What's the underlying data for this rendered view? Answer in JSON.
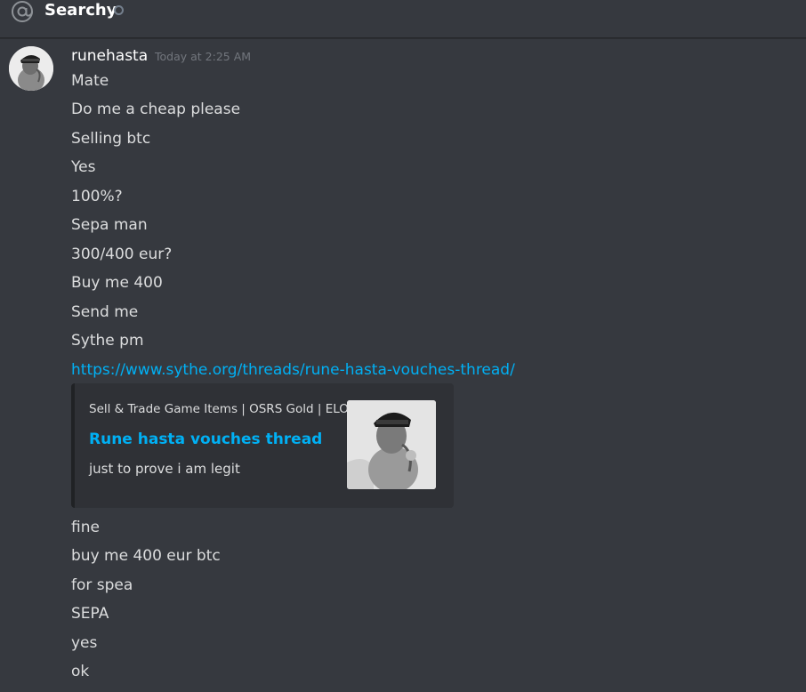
{
  "header": {
    "channel_name": "Searchy"
  },
  "message": {
    "username": "runehasta",
    "timestamp": "Today at 2:25 AM",
    "lines_before": [
      "Mate",
      "Do me a cheap please",
      "Selling btc",
      "Yes",
      "100%?",
      "Sepa man",
      "300/400 eur?",
      "Buy me 400",
      "Send me",
      "Sythe pm"
    ],
    "link": "https://www.sythe.org/threads/rune-hasta-vouches-thread/",
    "embed": {
      "provider": "Sell & Trade Game Items | OSRS Gold | ELO",
      "title": "Rune hasta vouches thread",
      "description": "just to prove i am legit"
    },
    "lines_after": [
      "fine",
      "buy me 400 eur btc",
      "for spea",
      "SEPA",
      "yes",
      "ok"
    ]
  },
  "colors": {
    "background": "#36393f",
    "text": "#dcddde",
    "link": "#00b0f4",
    "muted": "#72767d",
    "embed_bg": "#2f3136"
  },
  "icons": {
    "header_icon": "at-sign-icon",
    "status_icon": "offline-status-icon"
  }
}
